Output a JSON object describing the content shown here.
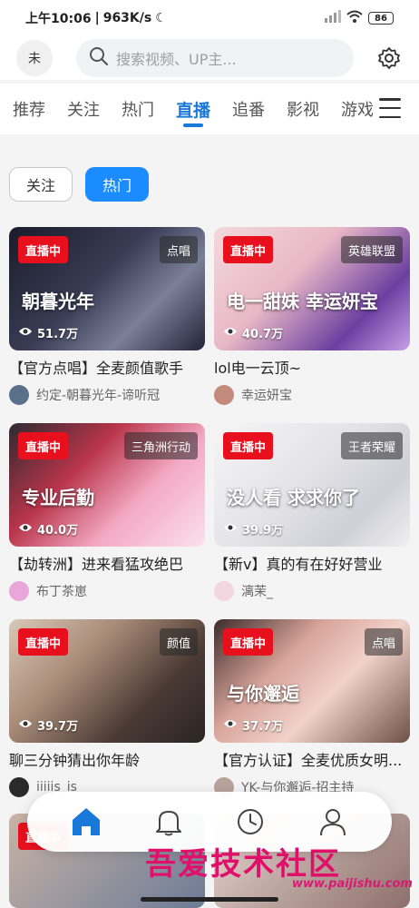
{
  "status_bar": {
    "time": "上午10:06",
    "speed": "963K/s",
    "battery": "86"
  },
  "header": {
    "avatar_text": "未",
    "search_placeholder": "搜索视频、UP主..."
  },
  "tabs": [
    "推荐",
    "关注",
    "热门",
    "直播",
    "追番",
    "影视",
    "游戏"
  ],
  "active_tab": "直播",
  "filters": {
    "follow": "关注",
    "hot": "热门"
  },
  "live_badge": "直播中",
  "cards": [
    {
      "title": "【官方点唱】全麦颜值歌手",
      "uploader": "约定-朝暮光年-谛听冠",
      "area": "点唱",
      "views": "51.7万",
      "overlay": "朝暮光年",
      "bg": "linear-gradient(135deg,#1a1c2a 0%,#3a3d55 45%,#7a7f98 70%,#22243a 100%)",
      "av": "#5a6f8a"
    },
    {
      "title": "lol电一云顶~",
      "uploader": "幸运妍宝",
      "area": "英雄联盟",
      "views": "40.7万",
      "overlay": "电一甜妹 幸运妍宝",
      "bg": "linear-gradient(135deg,#f3d9dc 0%,#e9b8c7 40%,#6b3fa0 75%,#c7a0e8 100%)",
      "av": "#c48a7c"
    },
    {
      "title": "【劫转洲】进来看猛攻绝巴",
      "uploader": "布丁茶崽",
      "area": "三角洲行动",
      "views": "40.0万",
      "overlay": "专业后勤",
      "bg": "linear-gradient(135deg,#2c2a31 0%,#b8344a 35%,#f4a9c4 65%,#fbe1ec 100%)",
      "av": "#e9a6d8"
    },
    {
      "title": "【新v】真的有在好好营业",
      "uploader": "漓茉_",
      "area": "王者荣耀",
      "views": "39.9万",
      "overlay": "没人看  求求你了",
      "bg": "linear-gradient(135deg,#f5f5f5 0%,#e4e4e8 45%,#cfcfd8 75%,#f0f0f0 100%)",
      "av": "#f2d6e0"
    },
    {
      "title": "聊三分钟猜出你年龄",
      "uploader": "iiiiis_is",
      "area": "颜值",
      "views": "39.7万",
      "overlay": "",
      "bg": "linear-gradient(135deg,#d9c8b8 0%,#a88b78 35%,#4a3a34 70%,#2a2422 100%)",
      "av": "#2a2a2a"
    },
    {
      "title": "【官方认证】全麦优质女明...",
      "uploader": "YK-与你邂逅-招主持",
      "area": "点唱",
      "views": "37.7万",
      "overlay": "与你邂逅",
      "bg": "linear-gradient(135deg,#3b2b2a 0%,#d8a49a 35%,#f1d2cb 60%,#6e5048 100%)",
      "av": "#b9a19c"
    }
  ],
  "watermark": {
    "text": "吾爱技术社区",
    "url": "www.paijishu.com"
  },
  "colors": {
    "accent": "#1a78d9",
    "live_red": "#e8101d",
    "chip_blue": "#1a8cff"
  },
  "icons": [
    "search-icon",
    "gear-icon",
    "menu-icon",
    "eye-icon",
    "home-icon",
    "bell-icon",
    "clock-icon",
    "user-icon"
  ]
}
